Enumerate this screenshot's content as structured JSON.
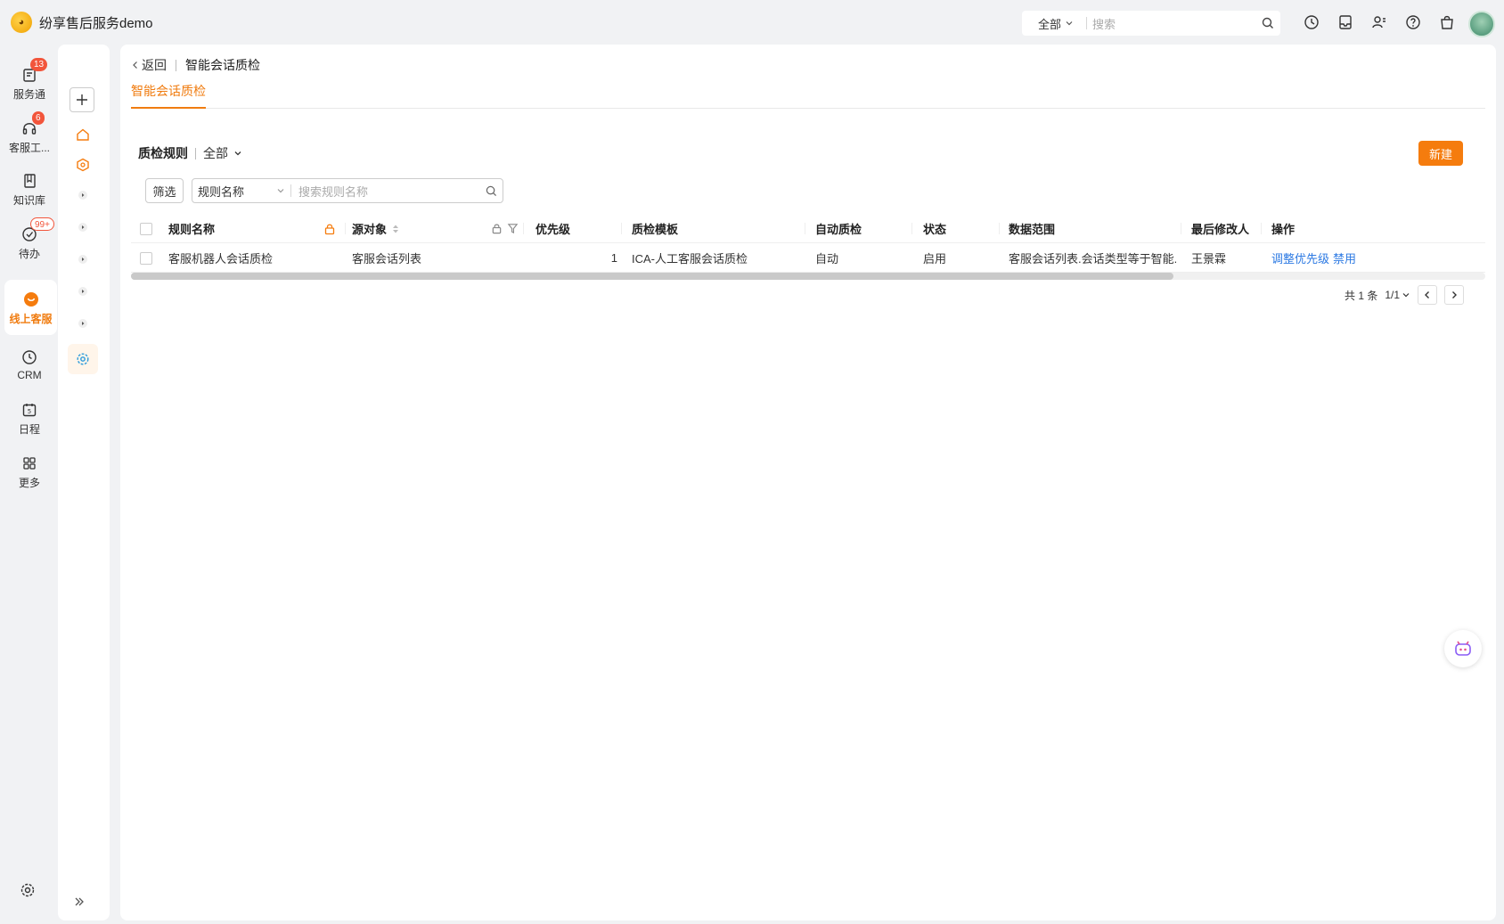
{
  "app": {
    "title": "纷享售后服务demo"
  },
  "top_search": {
    "scope": "全部",
    "placeholder": "搜索"
  },
  "nav_primary": [
    {
      "label": "服务通",
      "badge": "13",
      "icon": "service-icon"
    },
    {
      "label": "客服工...",
      "badge": "6",
      "icon": "headset-icon"
    },
    {
      "label": "知识库",
      "badge": "",
      "icon": "book-icon"
    },
    {
      "label": "待办",
      "badge": "99+",
      "icon": "todo-icon"
    },
    {
      "label": "线上客服",
      "badge": "",
      "icon": "chat-icon",
      "active": true
    },
    {
      "label": "CRM",
      "badge": "",
      "icon": "clock-icon"
    },
    {
      "label": "日程",
      "badge": "",
      "icon": "calendar-icon"
    },
    {
      "label": "更多",
      "badge": "",
      "icon": "grid-icon"
    }
  ],
  "calendar_day": "5",
  "breadcrumb": {
    "back": "返回",
    "current": "智能会话质检"
  },
  "tabs": [
    {
      "label": "智能会话质检",
      "active": true
    }
  ],
  "list": {
    "title": "质检规则",
    "view": "全部",
    "new_button": "新建"
  },
  "filter": {
    "button": "筛选",
    "field": "规则名称",
    "placeholder": "搜索规则名称"
  },
  "table": {
    "columns": [
      "规则名称",
      "源对象",
      "优先级",
      "质检模板",
      "自动质检",
      "状态",
      "数据范围",
      "最后修改人",
      "操作"
    ],
    "rows": [
      {
        "name": "客服机器人会话质检",
        "source": "客服会话列表",
        "priority": "1",
        "template": "ICA-人工客服会话质检",
        "auto": "自动",
        "status": "启用",
        "scope": "客服会话列表.会话类型等于智能...",
        "modifier": "王景霖",
        "actions": [
          "调整优先级",
          "禁用"
        ]
      }
    ]
  },
  "pager": {
    "total": "共 1 条",
    "pages": "1/1"
  },
  "colors": {
    "accent": "#f57c0e",
    "link": "#2d7ae3",
    "badge": "#f2553b"
  }
}
